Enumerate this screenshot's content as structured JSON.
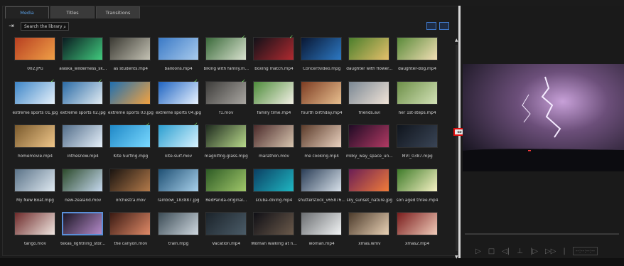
{
  "tabs": [
    {
      "label": "Media",
      "active": true
    },
    {
      "label": "Titles",
      "active": false
    },
    {
      "label": "Transitions",
      "active": false
    }
  ],
  "toolbar": {
    "search_placeholder": "Search the library",
    "import_icon": "import-icon",
    "search_icon": "search-icon",
    "view_icons": [
      "thumbnail-view-icon",
      "details-view-icon",
      "grid-view-icon"
    ]
  },
  "media": [
    {
      "label": "002.JPG",
      "checked": false,
      "colors": [
        "#b73f21",
        "#f0a047"
      ]
    },
    {
      "label": "alaska_wilderness_sk...",
      "checked": false,
      "colors": [
        "#0a1b20",
        "#41cb7e"
      ]
    },
    {
      "label": "as students.mp4",
      "checked": false,
      "colors": [
        "#3b3a33",
        "#c4c2b4"
      ]
    },
    {
      "label": "balloons.mp4",
      "checked": false,
      "colors": [
        "#3a79c6",
        "#a9cbed"
      ]
    },
    {
      "label": "biking with family.m...",
      "checked": true,
      "colors": [
        "#3b6a3b",
        "#d9e2cf"
      ]
    },
    {
      "label": "boxing match.mp4",
      "checked": true,
      "colors": [
        "#111118",
        "#b02a30"
      ]
    },
    {
      "label": "Concertvideo.mpg",
      "checked": false,
      "colors": [
        "#091733",
        "#2d79c4"
      ]
    },
    {
      "label": "daughter with flower...",
      "checked": false,
      "colors": [
        "#4b7e2c",
        "#e5c06b"
      ]
    },
    {
      "label": "daughter-dog.mp4",
      "checked": false,
      "colors": [
        "#5a8a3a",
        "#f2dfb5"
      ]
    },
    {
      "label": "extreme sports 01.jpg",
      "checked": true,
      "colors": [
        "#3d85c7",
        "#e6f1fa"
      ]
    },
    {
      "label": "extreme sports 02.jpg",
      "checked": true,
      "colors": [
        "#2a6aa5",
        "#e2ecf2"
      ]
    },
    {
      "label": "extreme sports 03.jpg",
      "checked": false,
      "colors": [
        "#1f6fb0",
        "#f2a240"
      ]
    },
    {
      "label": "extreme sports 04.jpg",
      "checked": true,
      "colors": [
        "#1f64c1",
        "#e9f3ff"
      ]
    },
    {
      "label": "f1.mov",
      "checked": true,
      "colors": [
        "#3e3d3b",
        "#a9a6a1"
      ]
    },
    {
      "label": "family time.mp4",
      "checked": false,
      "colors": [
        "#4d8b3a",
        "#f3f0e5"
      ]
    },
    {
      "label": "fourth birthday.mp4",
      "checked": false,
      "colors": [
        "#7c3c22",
        "#e8bf8f"
      ]
    },
    {
      "label": "friends.avi",
      "checked": false,
      "colors": [
        "#7a8793",
        "#f1e4d8"
      ]
    },
    {
      "label": "her 1st-steps.mp4",
      "checked": false,
      "colors": [
        "#6d8f48",
        "#d3e2b7"
      ]
    },
    {
      "label": "homemovie.mp4",
      "checked": false,
      "colors": [
        "#7a5a2d",
        "#f0c78a"
      ]
    },
    {
      "label": "inthesnow.mp4",
      "checked": false,
      "colors": [
        "#526d89",
        "#e7f1fb"
      ]
    },
    {
      "label": "Kite Surfing.mpg",
      "checked": true,
      "colors": [
        "#1f88c7",
        "#7ad9ff"
      ]
    },
    {
      "label": "kite-surf.mov",
      "checked": true,
      "colors": [
        "#2b9ed0",
        "#d9f4ff"
      ]
    },
    {
      "label": "magnifing-glass.mpg",
      "checked": false,
      "colors": [
        "#1f2b1f",
        "#b8d98b"
      ]
    },
    {
      "label": "marathon.mov",
      "checked": false,
      "colors": [
        "#4b2a2a",
        "#d8c6b0"
      ]
    },
    {
      "label": "me cooking.mp4",
      "checked": false,
      "colors": [
        "#5b3b2a",
        "#ead2c0"
      ]
    },
    {
      "label": "milky_way_space_un...",
      "checked": false,
      "colors": [
        "#200b25",
        "#b13a63"
      ]
    },
    {
      "label": "MVI_0387.mpg",
      "checked": false,
      "colors": [
        "#10151d",
        "#3a4556"
      ]
    },
    {
      "label": "My New Boat.mpg",
      "checked": false,
      "colors": [
        "#5b7388",
        "#dfe9f1"
      ]
    },
    {
      "label": "new-zealand.mov",
      "checked": false,
      "colors": [
        "#2c4a2b",
        "#c6d9ef"
      ]
    },
    {
      "label": "orchestra.mov",
      "checked": false,
      "colors": [
        "#1a1410",
        "#b37a4a"
      ]
    },
    {
      "label": "rainbow_183887.jpg",
      "checked": false,
      "colors": [
        "#1f5074",
        "#a8d0ea"
      ]
    },
    {
      "label": "RedPanda-original...",
      "checked": false,
      "colors": [
        "#2e5b25",
        "#a0c76a"
      ]
    },
    {
      "label": "scuba-diving.mp4",
      "checked": false,
      "colors": [
        "#0b3f63",
        "#1fb7c2"
      ]
    },
    {
      "label": "shutterstock_v65876...",
      "checked": false,
      "colors": [
        "#2b3e57",
        "#d8e1ea"
      ]
    },
    {
      "label": "sky_sunset_nature.jpg",
      "checked": false,
      "colors": [
        "#6b1e55",
        "#f07c3a"
      ]
    },
    {
      "label": "son aged three.mp4",
      "checked": false,
      "colors": [
        "#3f7b2a",
        "#f6f2c4"
      ]
    },
    {
      "label": "tango.mov",
      "checked": false,
      "colors": [
        "#6d2a2a",
        "#f0e6e0"
      ]
    },
    {
      "label": "texas_lightning_stor...",
      "checked": false,
      "selected": true,
      "colors": [
        "#1b1624",
        "#b389c7"
      ]
    },
    {
      "label": "the canyon.mov",
      "checked": false,
      "colors": [
        "#3a1a12",
        "#e08a68"
      ]
    },
    {
      "label": "train.mpg",
      "checked": false,
      "colors": [
        "#3b4b55",
        "#cfd8df"
      ]
    },
    {
      "label": "Vacation.mp4",
      "checked": false,
      "colors": [
        "#1b232a",
        "#4b5c68"
      ]
    },
    {
      "label": "Woman walking at n...",
      "checked": false,
      "colors": [
        "#0f0f15",
        "#6b5a4b"
      ]
    },
    {
      "label": "woman.mp4",
      "checked": false,
      "colors": [
        "#6a6d70",
        "#f2f4f5"
      ]
    },
    {
      "label": "xmas.wmv",
      "checked": false,
      "colors": [
        "#4c3b2b",
        "#e9d1b5"
      ]
    },
    {
      "label": "xmas2.mp4",
      "checked": false,
      "colors": [
        "#7a1d1d",
        "#f0cbb9"
      ]
    }
  ],
  "scrollbar": {
    "up_icon": "scroll-up-icon",
    "down_icon": "scroll-down-icon"
  },
  "divider": {
    "handle_icon": "resize-handle-icon",
    "handle_glyph": "⇔"
  },
  "preview": {
    "sky_colors": [
      "#12111a",
      "#6c4f7a",
      "#c7a0d8"
    ],
    "controls": [
      "▷",
      "□",
      "◁|",
      "⊥",
      "|▷",
      "▷▷",
      "|"
    ],
    "timecode": "--:--:--:--"
  }
}
